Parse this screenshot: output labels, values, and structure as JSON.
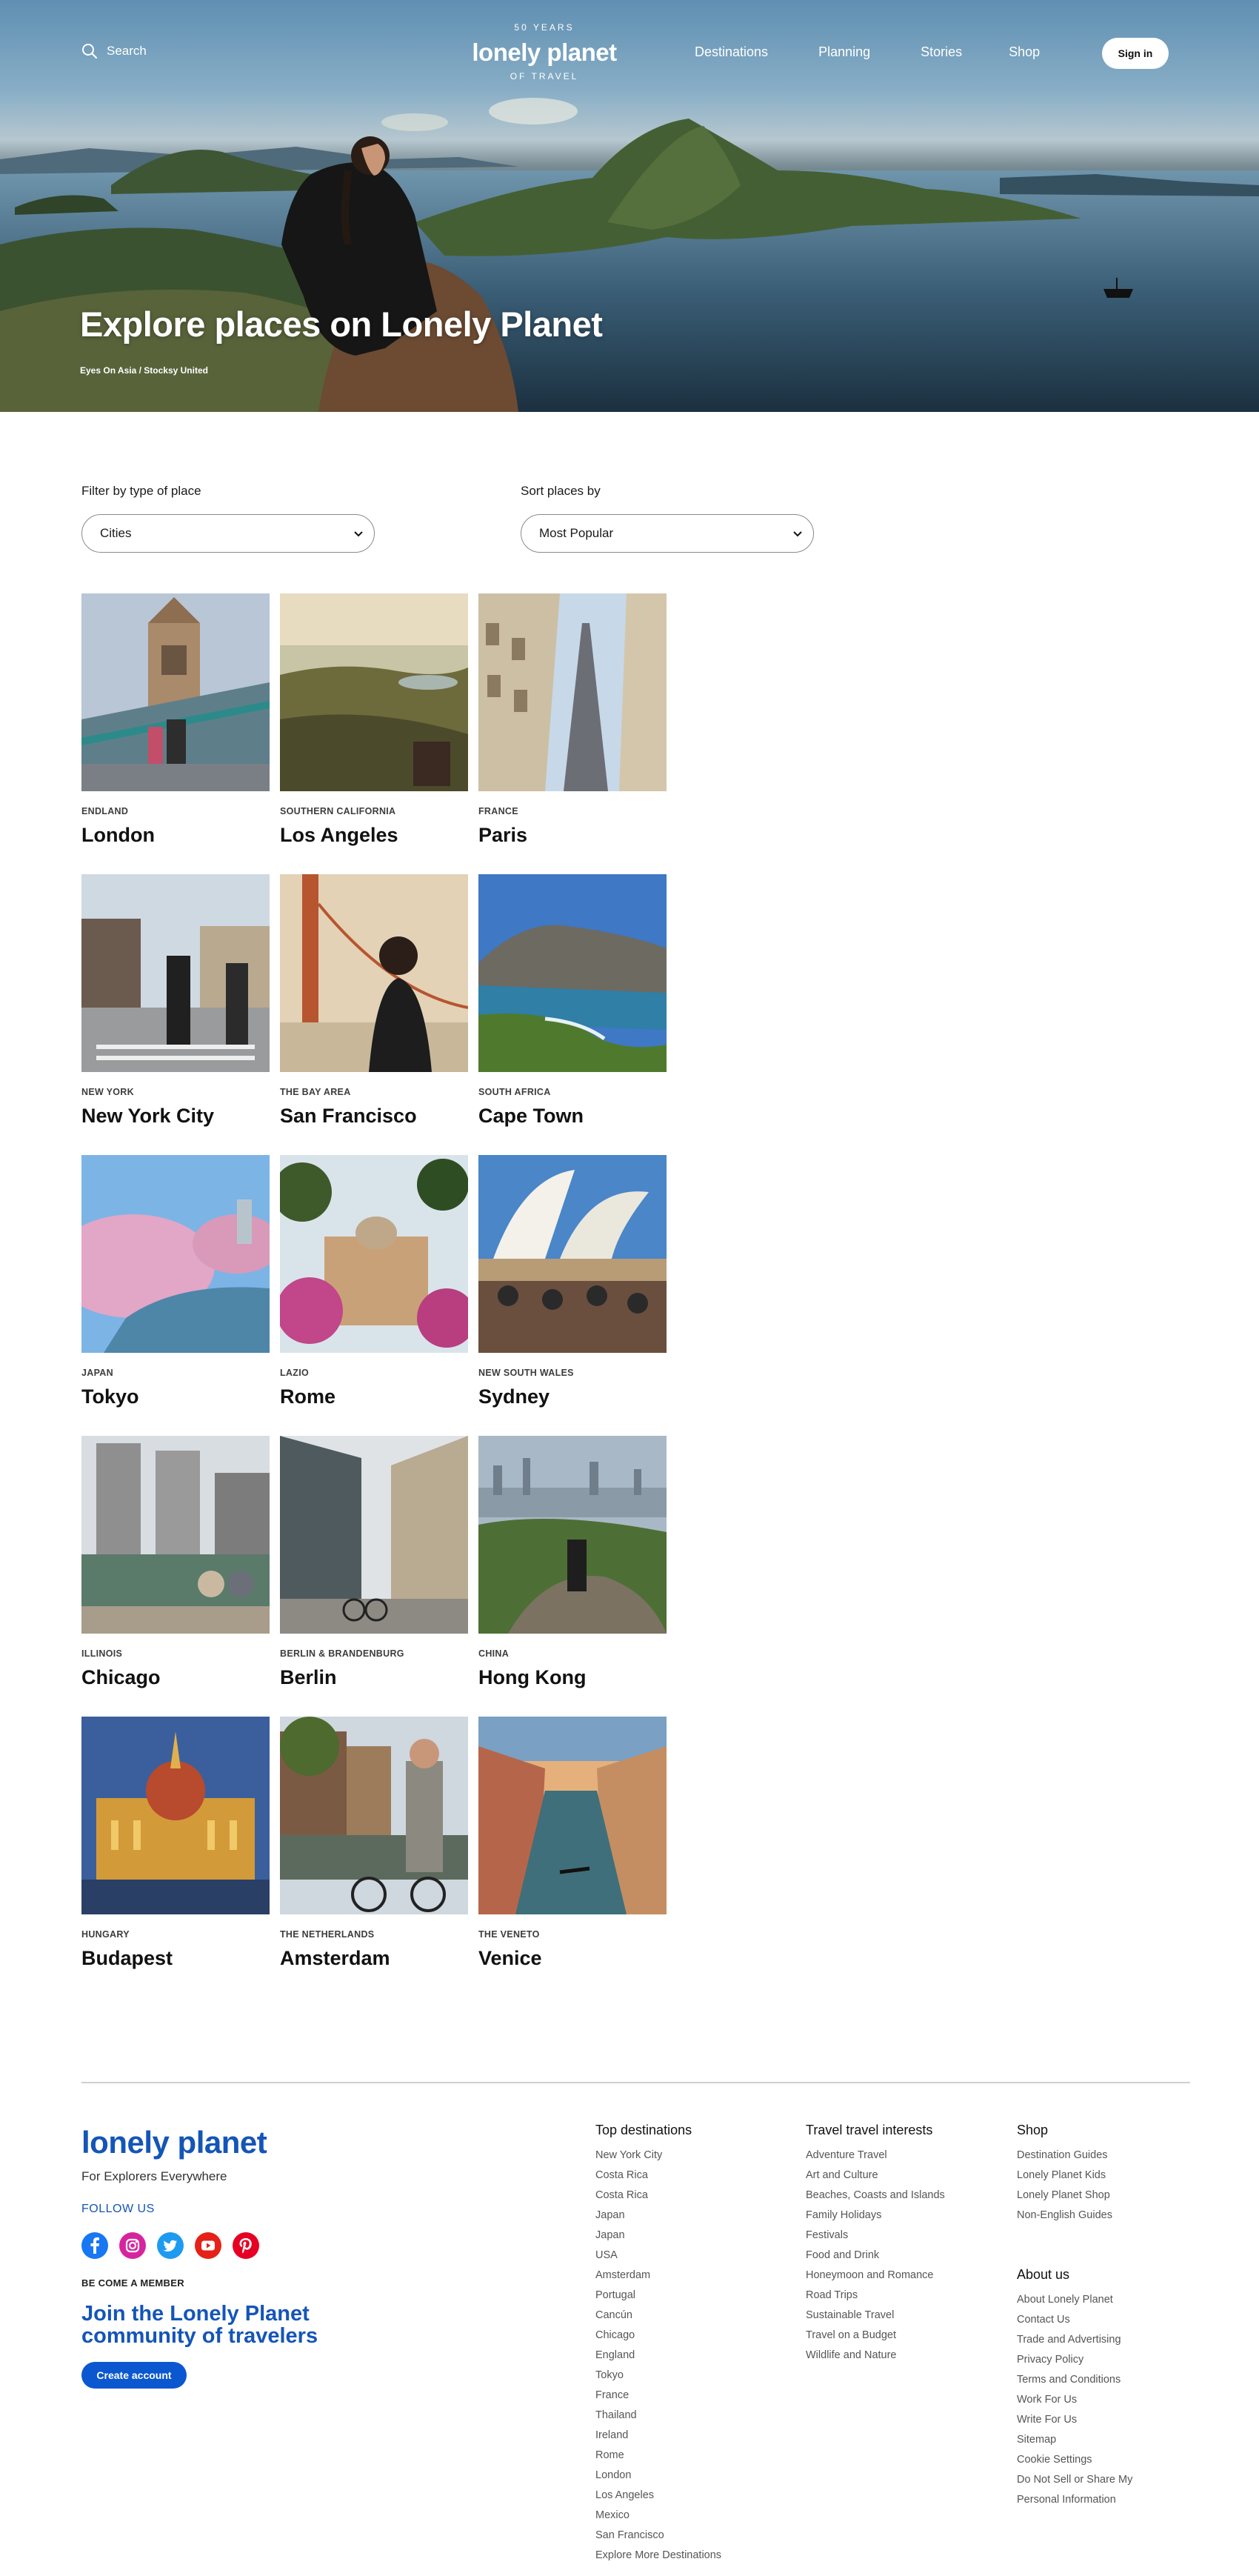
{
  "header": {
    "search_label": "Search",
    "logo": {
      "top_text": "50 YEARS",
      "wordmark": "lonely planet",
      "bottom_text": "OF TRAVEL"
    },
    "nav": [
      "Destinations",
      "Planning",
      "Stories",
      "Shop"
    ],
    "sign_in": "Sign in"
  },
  "hero": {
    "title": "Explore places on Lonely Planet",
    "credit": "Eyes On Asia / Stocksy United"
  },
  "filters": {
    "type_label": "Filter by type of place",
    "type_value": "Cities",
    "sort_label": "Sort places by",
    "sort_value": "Most Popular"
  },
  "places": [
    {
      "region": "ENDLAND",
      "city": "London"
    },
    {
      "region": "SOUTHERN CALIFORNIA",
      "city": "Los Angeles"
    },
    {
      "region": "FRANCE",
      "city": "Paris"
    },
    {
      "region": "NEW YORK",
      "city": "New York City"
    },
    {
      "region": "THE BAY AREA",
      "city": "San Francisco"
    },
    {
      "region": "SOUTH AFRICA",
      "city": "Cape Town"
    },
    {
      "region": "JAPAN",
      "city": "Tokyo"
    },
    {
      "region": "LAZIO",
      "city": "Rome"
    },
    {
      "region": "NEW SOUTH WALES",
      "city": "Sydney"
    },
    {
      "region": "ILLINOIS",
      "city": "Chicago"
    },
    {
      "region": "BERLIN & BRANDENBURG",
      "city": "Berlin"
    },
    {
      "region": "CHINA",
      "city": "Hong Kong"
    },
    {
      "region": "HUNGARY",
      "city": "Budapest"
    },
    {
      "region": "THE NETHERLANDS",
      "city": "Amsterdam"
    },
    {
      "region": "THE VENETO",
      "city": "Venice"
    }
  ],
  "footer": {
    "logo": "lonely planet",
    "tagline": "For Explorers Everywhere",
    "follow": "FOLLOW US",
    "socials": [
      "facebook-icon",
      "instagram-icon",
      "twitter-icon",
      "youtube-icon",
      "pinterest-icon"
    ],
    "member_label": "BE COME A MEMBER",
    "join_text": "Join the Lonely Planet community of travelers",
    "cta": "Create account",
    "columns": {
      "top_destinations": {
        "title": "Top destinations",
        "links": [
          "New York City",
          "Costa Rica",
          "Costa Rica",
          "Japan",
          "Japan",
          "USA",
          "Amsterdam",
          "Portugal",
          "Cancún",
          "Chicago",
          "England",
          "Tokyo",
          "France",
          "Thailand",
          "Ireland",
          "Rome",
          "London",
          "Los Angeles",
          "Mexico",
          "San Francisco",
          "Explore More Destinations"
        ]
      },
      "interests": {
        "title": "Travel travel interests",
        "links": [
          "Adventure Travel",
          "Art and Culture",
          "Beaches, Coasts and Islands",
          "Family Holidays",
          "Festivals",
          "Food and Drink",
          "Honeymoon and Romance",
          "Road Trips",
          "Sustainable Travel",
          "Travel on a Budget",
          "Wildlife and Nature"
        ]
      },
      "shop": {
        "title": "Shop",
        "links": [
          "Destination Guides",
          "Lonely Planet Kids",
          "Lonely Planet Shop",
          "Non-English Guides"
        ]
      },
      "about": {
        "title": "About us",
        "links": [
          "About Lonely Planet",
          "Contact Us",
          "Trade and Advertising",
          "Privacy Policy",
          "Terms and Conditions",
          "Work For Us",
          "Write For Us",
          "Sitemap",
          "Cookie Settings",
          "Do Not Sell or Share My",
          "Personal Information"
        ]
      }
    }
  },
  "colors": {
    "brand_blue": "#1455b8",
    "cta_blue": "#0b57d0",
    "link_gray": "#555555"
  }
}
